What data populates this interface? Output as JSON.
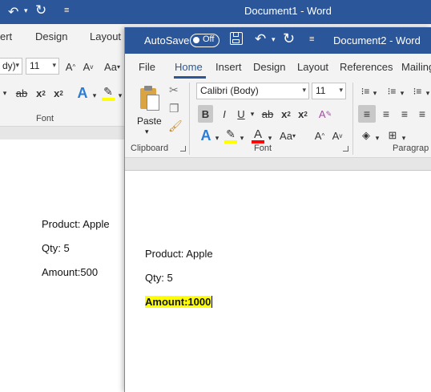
{
  "colors": {
    "accent": "#2b579a",
    "highlight": "#ffff00",
    "font_color_bar": "#ff0000"
  },
  "window1": {
    "title": "Document1  -  Word",
    "tabs": [
      "ert",
      "Design",
      "Layout"
    ],
    "font_name_partial": "dy)",
    "font_size": "11",
    "font_group_label": "Font",
    "doc_lines": [
      "Product: Apple",
      "Qty: 5",
      "Amount:500"
    ]
  },
  "window2": {
    "autosave_label": "AutoSave",
    "autosave_state": "Off",
    "title": "Document2  -  Word",
    "tabs": [
      "File",
      "Home",
      "Insert",
      "Design",
      "Layout",
      "References",
      "Mailing"
    ],
    "active_tab": "Home",
    "clipboard": {
      "paste_label": "Paste",
      "group_label": "Clipboard"
    },
    "font": {
      "name": "Calibri (Body)",
      "size": "11",
      "group_label": "Font"
    },
    "paragraph_group_label": "Paragrap",
    "doc_lines": [
      "Product: Apple",
      "Qty: 5",
      "Amount:1000"
    ]
  }
}
